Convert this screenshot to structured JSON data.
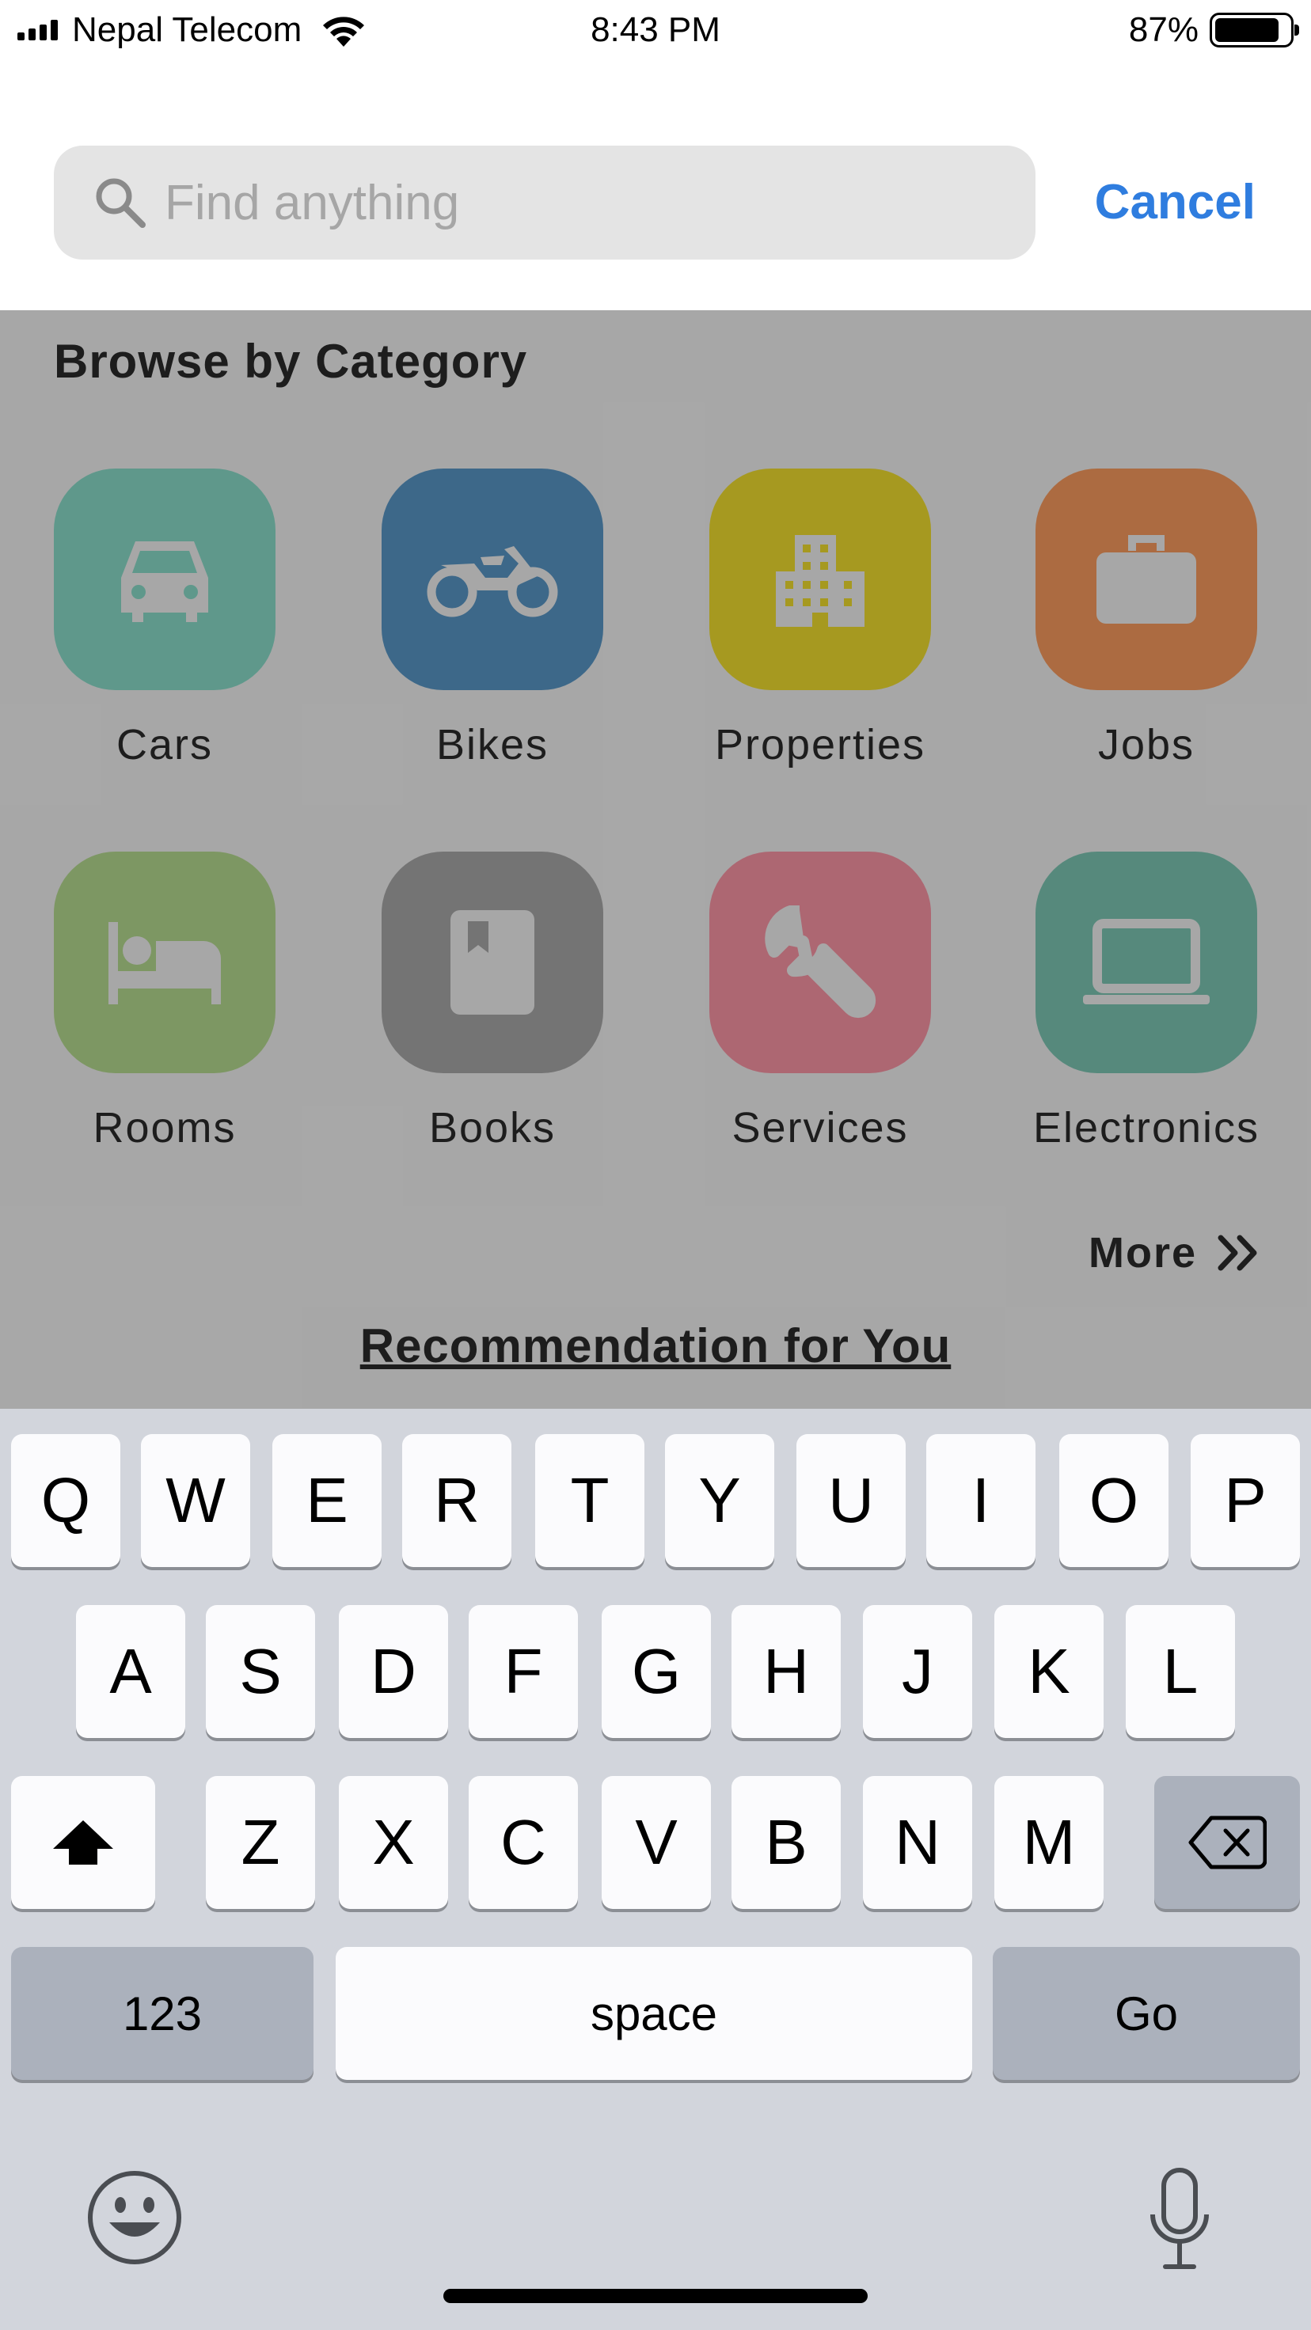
{
  "status_bar": {
    "carrier": "Nepal Telecom",
    "time": "8:43 PM",
    "battery_percent": "87%",
    "battery_level": 0.87,
    "signal_icon": "signal-bars-icon",
    "wifi_icon": "wifi-icon",
    "battery_icon": "battery-icon"
  },
  "search": {
    "placeholder": "Find anything",
    "value": "",
    "cancel_label": "Cancel",
    "icon": "search-icon",
    "cancel_color": "#2f7ddf"
  },
  "browse": {
    "title": "Browse by Category",
    "categories": [
      {
        "label": "Cars",
        "icon": "car-icon",
        "color": "#88dac8"
      },
      {
        "label": "Bikes",
        "icon": "motorbike-icon",
        "color": "#5896c4"
      },
      {
        "label": "Properties",
        "icon": "building-icon",
        "color": "#eedb2e"
      },
      {
        "label": "Jobs",
        "icon": "briefcase-icon",
        "color": "#f69a5e"
      },
      {
        "label": "Rooms",
        "icon": "bed-icon",
        "color": "#b4d88e"
      },
      {
        "label": "Books",
        "icon": "book-icon",
        "color": "#a6a6a6"
      },
      {
        "label": "Services",
        "icon": "wrench-icon",
        "color": "#f894a4"
      },
      {
        "label": "Electronics",
        "icon": "laptop-icon",
        "color": "#7cc4b2"
      }
    ],
    "more_label": "More",
    "more_icon": "double-chevron-right-icon"
  },
  "recommendation_title": "Recommendation for You",
  "keyboard": {
    "row1": [
      "Q",
      "W",
      "E",
      "R",
      "T",
      "Y",
      "U",
      "I",
      "O",
      "P"
    ],
    "row2": [
      "A",
      "S",
      "D",
      "F",
      "G",
      "H",
      "J",
      "K",
      "L"
    ],
    "row3": [
      "Z",
      "X",
      "C",
      "V",
      "B",
      "N",
      "M"
    ],
    "shift_icon": "shift-icon",
    "backspace_icon": "backspace-icon",
    "numbers_label": "123",
    "space_label": "space",
    "go_label": "Go",
    "emoji_icon": "emoji-icon",
    "mic_icon": "microphone-icon"
  }
}
